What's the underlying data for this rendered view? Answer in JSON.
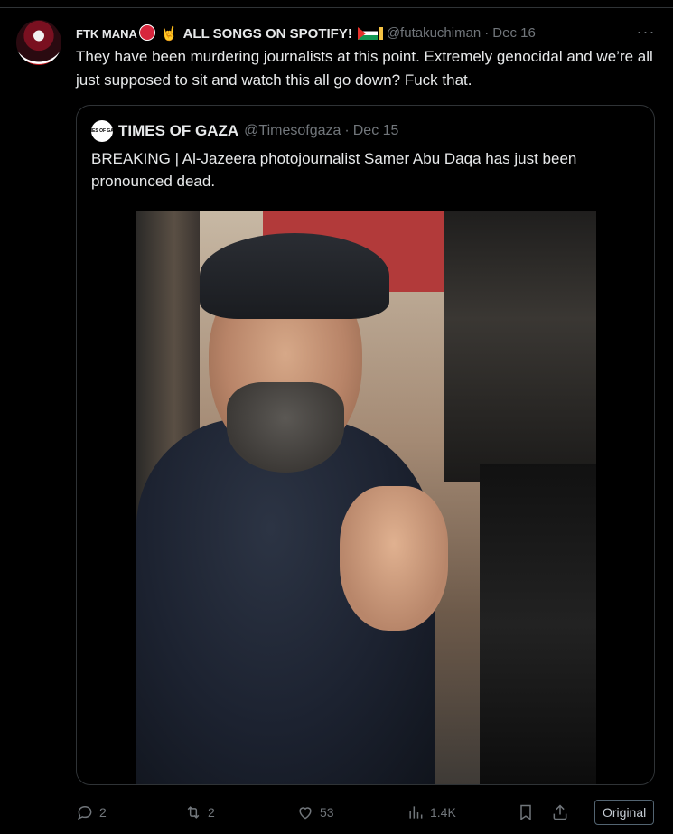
{
  "tweet": {
    "author_name_prefix": "FTK MANA",
    "author_name_suffix": "ALL SONGS ON SPOTIFY!",
    "handle": "@futakuchiman",
    "separator": "·",
    "date": "Dec 16",
    "more_glyph": "···",
    "text": "They have been murdering journalists at this point. Extremely genocidal and we’re all just supposed to sit and watch this all go down? Fuck that."
  },
  "quote": {
    "avatar_text": "TIMES OF GAZA",
    "name": "TIMES OF GAZA",
    "handle": "@Timesofgaza",
    "separator": "·",
    "date": "Dec 15",
    "text": "BREAKING | Al-Jazeera photojournalist Samer Abu Daqa has just been pronounced dead."
  },
  "actions": {
    "replies": "2",
    "reposts": "2",
    "likes": "53",
    "views": "1.4K",
    "original_badge": "Original"
  },
  "colors": {
    "background": "#000000",
    "text_primary": "#e7e9ea",
    "text_secondary": "#71767b",
    "border": "#2f3336"
  },
  "icons": [
    "reply-icon",
    "repost-icon",
    "like-icon",
    "views-icon",
    "bookmark-icon",
    "share-icon",
    "more-icon"
  ]
}
